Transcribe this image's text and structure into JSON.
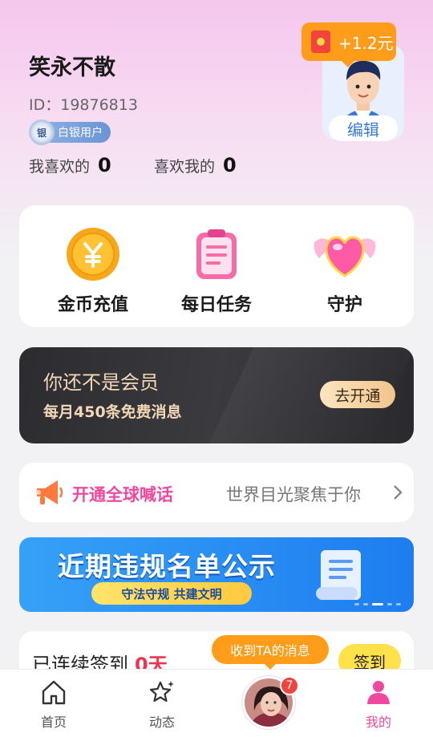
{
  "profile": {
    "username": "笑永不散",
    "user_id": "ID：19876813",
    "badge_label": "白银用户",
    "badge_medal": "银",
    "i_like_label": "我喜欢的",
    "i_like_count": "0",
    "liked_me_label": "喜欢我的",
    "liked_me_count": "0",
    "edit_label": "编辑",
    "reward_label": "+1.2元"
  },
  "quick_actions": [
    {
      "label": "金币充值",
      "icon": "gold-coin-icon"
    },
    {
      "label": "每日任务",
      "icon": "task-clipboard-icon"
    },
    {
      "label": "守护",
      "icon": "winged-heart-icon"
    }
  ],
  "vip": {
    "title": "你还不是会员",
    "subtitle": "每月450条免费消息",
    "button": "去开通"
  },
  "shout": {
    "title": "开通全球喊话",
    "subtitle": "世界目光聚焦于你"
  },
  "banner": {
    "title": "近期违规名单公示",
    "subtitle": "守法守规 共建文明"
  },
  "checkin": {
    "label": "已连续签到",
    "days": "0天",
    "button": "签到"
  },
  "tabbar": {
    "home": "首页",
    "feed": "动态",
    "mine": "我的",
    "message_tip": "收到TA的消息",
    "message_count": "7"
  },
  "colors": {
    "accent_pink": "#f0489e",
    "orange": "#ff9d1a",
    "vip_gold": "#f2d7b6",
    "banner_blue": "#1d7df0",
    "checkin_yellow": "#ffe14a"
  }
}
